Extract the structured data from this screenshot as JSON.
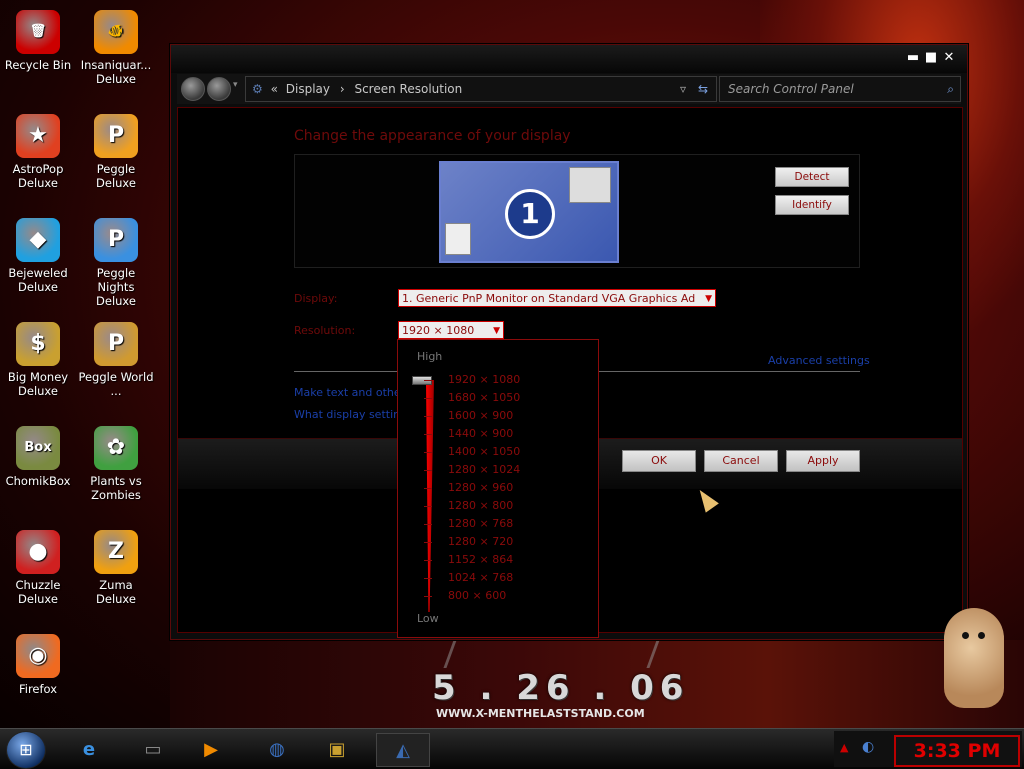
{
  "wallpaper": {
    "date": "5 . 26 . 06",
    "url": "WWW.X-MENTHELASTSTAND.COM"
  },
  "desktop_icons": [
    {
      "label": "Recycle Bin",
      "icon": "recycle-bin-icon",
      "glyph": "🗑"
    },
    {
      "label": "Insaniquar... Deluxe",
      "icon": "fish-icon",
      "glyph": "🐠"
    },
    {
      "label": "AstroPop Deluxe",
      "icon": "astropop-icon",
      "glyph": "★"
    },
    {
      "label": "Peggle Deluxe",
      "icon": "peggle-icon",
      "glyph": "P"
    },
    {
      "label": "Bejeweled Deluxe",
      "icon": "diamond-icon",
      "glyph": "◆"
    },
    {
      "label": "Peggle Nights Deluxe",
      "icon": "peggle-nights-icon",
      "glyph": "P"
    },
    {
      "label": "Big Money Deluxe",
      "icon": "money-bag-icon",
      "glyph": "$"
    },
    {
      "label": "Peggle World ...",
      "icon": "peggle-world-icon",
      "glyph": "P"
    },
    {
      "label": "ChomikBox",
      "icon": "hamster-box-icon",
      "glyph": "Box"
    },
    {
      "label": "Plants vs Zombies",
      "icon": "flower-icon",
      "glyph": "✿"
    },
    {
      "label": "Chuzzle Deluxe",
      "icon": "chuzzle-icon",
      "glyph": "●"
    },
    {
      "label": "Zuma Deluxe",
      "icon": "zuma-icon",
      "glyph": "Z"
    },
    {
      "label": "Firefox",
      "icon": "firefox-icon",
      "glyph": "◉"
    }
  ],
  "window": {
    "breadcrumb": {
      "prefix": "«",
      "part1": "Display",
      "sep": "›",
      "part2": "Screen Resolution"
    },
    "search_placeholder": "Search Control Panel",
    "heading": "Change the appearance of your display",
    "monitor_number": "1",
    "detect_label": "Detect",
    "identify_label": "Identify",
    "display_label": "Display:",
    "display_value": "1. Generic PnP Monitor on Standard VGA Graphics Ad",
    "resolution_label": "Resolution:",
    "resolution_value": "1920 × 1080",
    "advanced_link": "Advanced settings",
    "link_text_size": "Make text and other",
    "link_display_settings": "What display settings",
    "ok_label": "OK",
    "cancel_label": "Cancel",
    "apply_label": "Apply"
  },
  "dropdown": {
    "high_label": "High",
    "low_label": "Low",
    "options": [
      "1920 × 1080",
      "1680 × 1050",
      "1600 × 900",
      "1440 × 900",
      "1400 × 1050",
      "1280 × 1024",
      "1280 × 960",
      "1280 × 800",
      "1280 × 768",
      "1280 × 720",
      "1152 × 864",
      "1024 × 768",
      "800 × 600"
    ]
  },
  "taskbar": {
    "clock": "3:33 PM"
  },
  "colors": {
    "accent": "#8b0b0b",
    "link": "#1a3fa8",
    "clock": "#e00000"
  }
}
